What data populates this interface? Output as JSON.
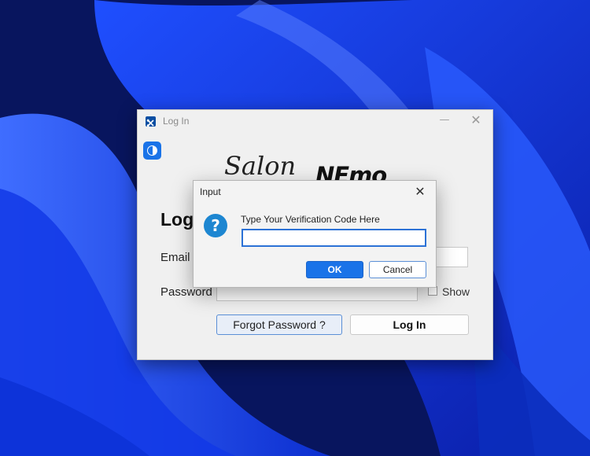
{
  "login_window": {
    "title": "Log In",
    "minimize_glyph": "—",
    "close_glyph": "✕",
    "logo_script": "Salon",
    "logo_bold": "NEmo",
    "heading": "Log",
    "email_label": "Email",
    "email_value": "",
    "password_label": "Password",
    "password_value": "",
    "show_label": "Show",
    "forgot_button": "Forgot Password ?",
    "login_button": "Log In"
  },
  "dialog": {
    "title": "Input",
    "close_glyph": "✕",
    "icon_glyph": "?",
    "prompt": "Type Your Verification Code Here",
    "input_value": "",
    "ok_button": "OK",
    "cancel_button": "Cancel"
  },
  "colors": {
    "accent": "#1a73e8",
    "wallpaper": "#0a2ad8"
  }
}
